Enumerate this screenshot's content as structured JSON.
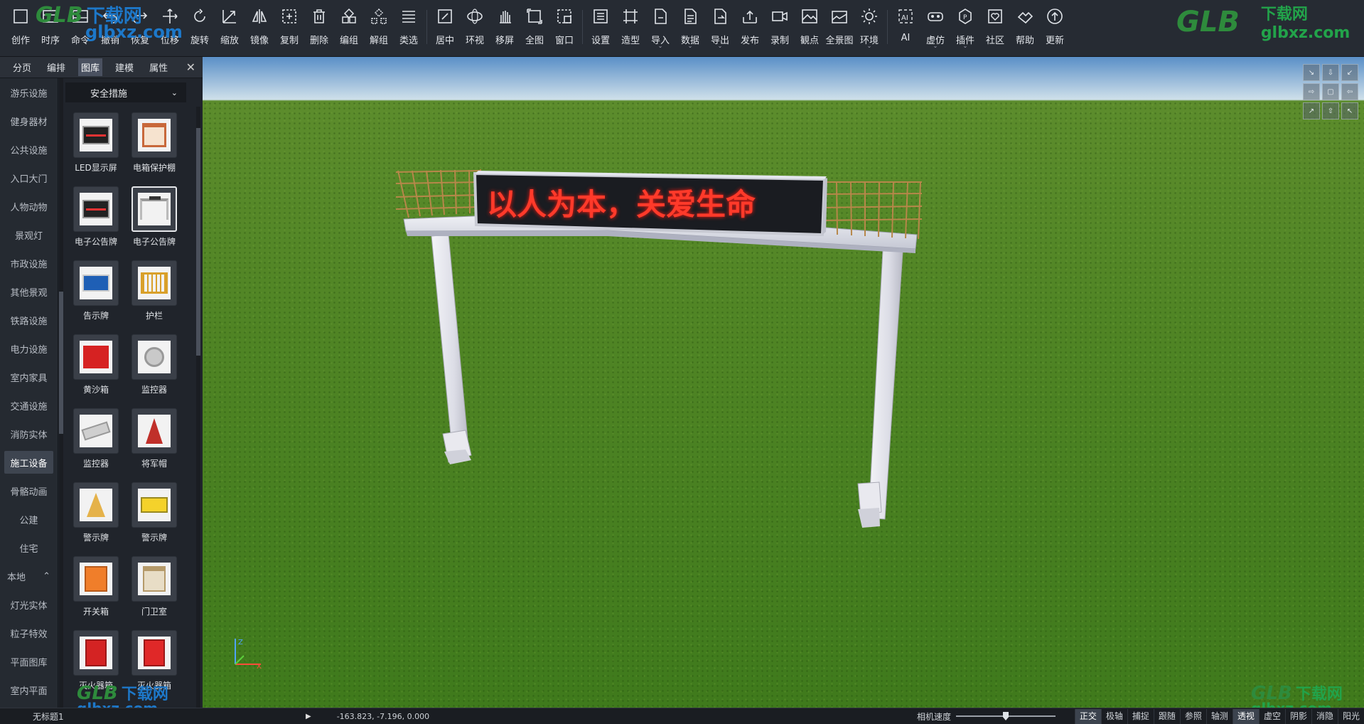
{
  "toolbar": {
    "group1": [
      {
        "label": "创作",
        "icon": "create-icon"
      },
      {
        "label": "时序",
        "icon": "timeline-icon"
      },
      {
        "label": "命令",
        "icon": "command-icon"
      },
      {
        "label": "撤销",
        "icon": "undo-icon"
      },
      {
        "label": "恢复",
        "icon": "redo-icon"
      },
      {
        "label": "位移",
        "icon": "move-icon"
      },
      {
        "label": "旋转",
        "icon": "rotate-icon"
      },
      {
        "label": "缩放",
        "icon": "scale-icon"
      },
      {
        "label": "镜像",
        "icon": "mirror-icon"
      },
      {
        "label": "复制",
        "icon": "copy-icon"
      },
      {
        "label": "删除",
        "icon": "delete-icon"
      },
      {
        "label": "编组",
        "icon": "group-icon"
      },
      {
        "label": "解组",
        "icon": "ungroup-icon"
      },
      {
        "label": "类选",
        "icon": "class-select-icon"
      }
    ],
    "group2": [
      {
        "label": "居中",
        "icon": "center-icon"
      },
      {
        "label": "环视",
        "icon": "orbit-icon"
      },
      {
        "label": "移屏",
        "icon": "pan-hand-icon"
      },
      {
        "label": "全图",
        "icon": "zoom-extents-icon"
      },
      {
        "label": "窗口",
        "icon": "zoom-window-icon"
      }
    ],
    "group3": [
      {
        "label": "设置",
        "icon": "settings-icon",
        "caret": false
      },
      {
        "label": "造型",
        "icon": "modeling-icon",
        "caret": false
      },
      {
        "label": "导入",
        "icon": "import-icon",
        "caret": true
      },
      {
        "label": "数据",
        "icon": "data-icon",
        "caret": true
      },
      {
        "label": "导出",
        "icon": "export-icon",
        "caret": true
      },
      {
        "label": "发布",
        "icon": "publish-icon",
        "caret": false
      },
      {
        "label": "录制",
        "icon": "record-icon",
        "caret": false
      },
      {
        "label": "観点",
        "icon": "viewpoint-icon",
        "caret": false
      },
      {
        "label": "全景图",
        "icon": "panorama-icon",
        "caret": false
      },
      {
        "label": "环境",
        "icon": "environment-icon",
        "caret": true
      }
    ],
    "group4": [
      {
        "label": "AI",
        "icon": "ai-icon",
        "caret": false
      },
      {
        "label": "虚仿",
        "icon": "vr-icon",
        "caret": true
      },
      {
        "label": "插件",
        "icon": "plugin-icon",
        "caret": true
      },
      {
        "label": "社区",
        "icon": "community-icon",
        "caret": false
      },
      {
        "label": "帮助",
        "icon": "help-icon",
        "caret": false
      },
      {
        "label": "更新",
        "icon": "update-icon",
        "caret": false
      }
    ]
  },
  "watermark": {
    "glb": "GLB",
    "cn": "下载网",
    "url": "glbxz.com"
  },
  "panel": {
    "tabs": [
      "分页",
      "编排",
      "图库",
      "建模",
      "属性"
    ],
    "active_tab": "图库",
    "close": "✕",
    "categories": [
      "游乐设施",
      "健身器材",
      "公共设施",
      "入口大门",
      "人物动物",
      "景观灯",
      "市政设施",
      "其他景观",
      "铁路设施",
      "电力设施",
      "室内家具",
      "交通设施",
      "消防实体",
      "施工设备",
      "骨骼动画",
      "公建",
      "住宅"
    ],
    "active_category": "施工设备",
    "section_local": "本地",
    "local_items": [
      "灯光实体",
      "粒子特效",
      "平面图库",
      "室内平面"
    ],
    "dropdown": "安全措施",
    "items": [
      {
        "name": "LED显示屏",
        "kind": "led"
      },
      {
        "name": "电箱保护棚",
        "kind": "shed"
      },
      {
        "name": "电子公告牌",
        "kind": "led"
      },
      {
        "name": "电子公告牌",
        "kind": "gantry"
      },
      {
        "name": "告示牌",
        "kind": "notice"
      },
      {
        "name": "护栏",
        "kind": "fence"
      },
      {
        "name": "黄沙箱",
        "kind": "redbox"
      },
      {
        "name": "监控器",
        "kind": "camera"
      },
      {
        "name": "监控器",
        "kind": "camera2"
      },
      {
        "name": "将军帽",
        "kind": "cone"
      },
      {
        "name": "警示牌",
        "kind": "warn"
      },
      {
        "name": "警示牌",
        "kind": "yellow"
      },
      {
        "name": "开关箱",
        "kind": "orangebox"
      },
      {
        "name": "门卫室",
        "kind": "booth"
      },
      {
        "name": "灭火器箱",
        "kind": "redcab"
      },
      {
        "name": "灭火器箱",
        "kind": "redcab2"
      }
    ],
    "selected_index": 3
  },
  "viewport": {
    "sign_text": "以人为本，关爱生命",
    "nav_cube": [
      "↘",
      "⇩",
      "↙",
      "⇨",
      "▢",
      "⇦",
      "↗",
      "⇧",
      "↖"
    ],
    "axes": {
      "z": "Z",
      "x": "X"
    }
  },
  "status": {
    "doc_name": "无标题1",
    "coords": "-163.823, -7.196, 0.000",
    "camera_speed_label": "相机速度",
    "camera_speed": 0.5,
    "toggles": [
      "正交",
      "极轴",
      "捕捉",
      "跟随",
      "参照",
      "轴测",
      "透视",
      "虚空",
      "阴影",
      "消隐",
      "阳光"
    ],
    "active_toggles": [
      "正交",
      "透视"
    ]
  }
}
